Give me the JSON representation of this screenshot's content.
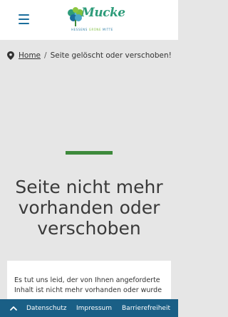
{
  "header": {
    "logo": {
      "word": "Mucke",
      "tagline_part1": "HESSENS",
      "tagline_part2": "GRÜNE",
      "tagline_part3": "MITTE"
    }
  },
  "breadcrumb": {
    "home": "Home",
    "separator": "/",
    "current": "Seite gelöscht oder verschoben!"
  },
  "main": {
    "title": "Seite nicht mehr vorhanden oder verschoben",
    "body_text": "Es tut uns leid, der von Ihnen angeforderte Inhalt ist nicht mehr vorhanden oder wurde"
  },
  "footer": {
    "links": [
      "Datenschutz",
      "Impressum",
      "Barrierefreiheit"
    ]
  },
  "colors": {
    "accent_blue": "#1a5f86",
    "accent_green": "#3d8a3b",
    "background": "#e6e6e6"
  }
}
